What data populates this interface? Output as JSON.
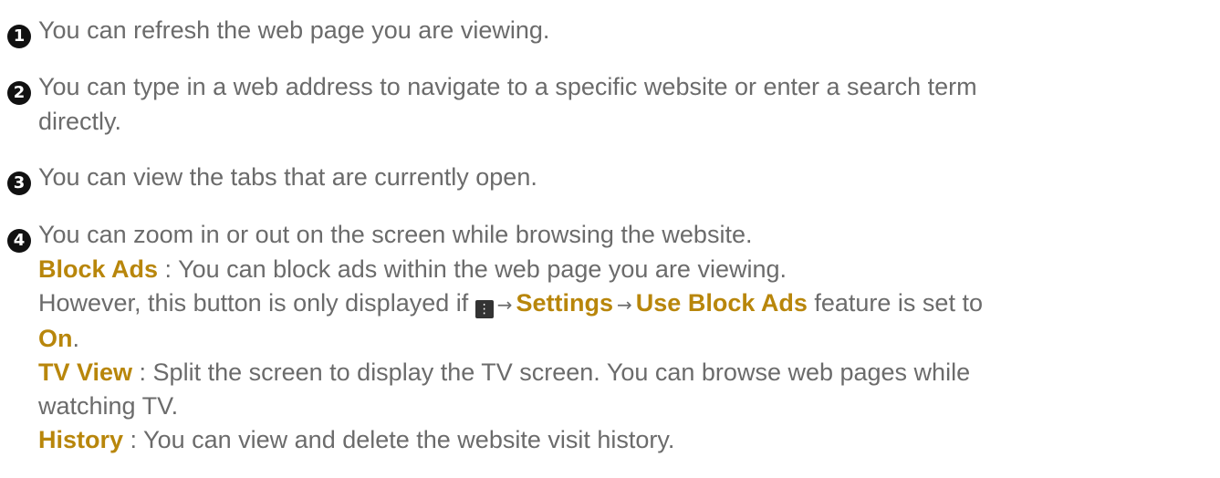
{
  "items": [
    {
      "number": "1",
      "text": "You can refresh the web page you are viewing."
    },
    {
      "number": "2",
      "line1": "You can type in a web address to navigate to a specific website or enter a search term",
      "line2": "directly."
    },
    {
      "number": "3",
      "text": "You can view the tabs that are currently open."
    },
    {
      "number": "4",
      "text": "You can zoom in or out on the screen while browsing the website."
    }
  ],
  "block_ads": {
    "label": "Block Ads",
    "desc": " : You can block ads within the web page you are viewing.",
    "note_prefix": "However, this button is only displayed if ",
    "settings": "Settings",
    "use_block_ads": "Use Block Ads",
    "note_suffix": " feature is set to",
    "on": "On",
    "period": "."
  },
  "tv_view": {
    "label": "TV View",
    "desc_line1": " : Split the screen to display the TV screen. You can browse web pages while",
    "desc_line2": "watching TV."
  },
  "history": {
    "label": "History",
    "desc": " : You can view and delete the website visit history."
  },
  "icons": {
    "menu": "⋮",
    "arrow": "→"
  },
  "colors": {
    "text": "#6b6b6b",
    "highlight": "#b8860b",
    "badge": "#111111"
  }
}
